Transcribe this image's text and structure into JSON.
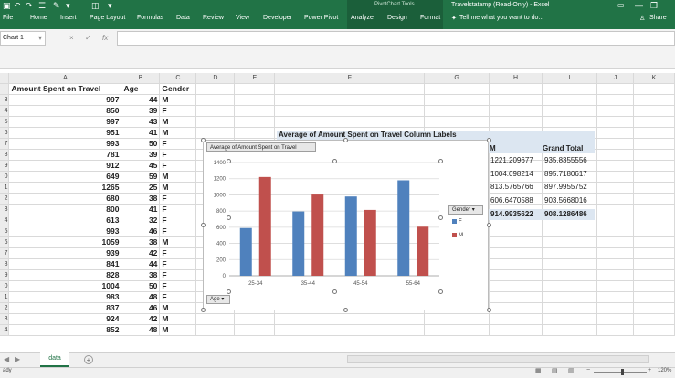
{
  "ribbon": {
    "context_header": "PivotChart Tools",
    "title": "Travelstatamp (Read-Only) - Excel",
    "file_label": "File",
    "tabs": [
      "Home",
      "Insert",
      "Page Layout",
      "Formulas",
      "Data",
      "Review",
      "View",
      "Developer",
      "Power Pivot",
      "Analyze",
      "Design",
      "Format"
    ],
    "tell_me": "Tell me what you want to do...",
    "share": "Share"
  },
  "formula_bar": {
    "name_box": "Chart 1",
    "fx": "fx",
    "cancel": "×",
    "confirm": "✓"
  },
  "grid": {
    "columns": [
      "A",
      "B",
      "C",
      "D",
      "E",
      "F",
      "G",
      "H",
      "I",
      "J",
      "K"
    ],
    "header_row": {
      "row": "",
      "a": "Amount Spent on Travel",
      "b": "Age",
      "c": "Gender"
    },
    "rows": [
      {
        "r": "3",
        "a": "997",
        "b": "44",
        "c": "M"
      },
      {
        "r": "4",
        "a": "850",
        "b": "39",
        "c": "F"
      },
      {
        "r": "5",
        "a": "997",
        "b": "43",
        "c": "M"
      },
      {
        "r": "6",
        "a": "951",
        "b": "41",
        "c": "M"
      },
      {
        "r": "7",
        "a": "993",
        "b": "50",
        "c": "F"
      },
      {
        "r": "8",
        "a": "781",
        "b": "39",
        "c": "F"
      },
      {
        "r": "9",
        "a": "912",
        "b": "45",
        "c": "F"
      },
      {
        "r": "0",
        "a": "649",
        "b": "59",
        "c": "M"
      },
      {
        "r": "1",
        "a": "1265",
        "b": "25",
        "c": "M"
      },
      {
        "r": "2",
        "a": "680",
        "b": "38",
        "c": "F"
      },
      {
        "r": "3",
        "a": "800",
        "b": "41",
        "c": "F"
      },
      {
        "r": "4",
        "a": "613",
        "b": "32",
        "c": "F"
      },
      {
        "r": "5",
        "a": "993",
        "b": "46",
        "c": "F"
      },
      {
        "r": "6",
        "a": "1059",
        "b": "38",
        "c": "M"
      },
      {
        "r": "7",
        "a": "939",
        "b": "42",
        "c": "F"
      },
      {
        "r": "8",
        "a": "841",
        "b": "44",
        "c": "F"
      },
      {
        "r": "9",
        "a": "828",
        "b": "38",
        "c": "F"
      },
      {
        "r": "0",
        "a": "1004",
        "b": "50",
        "c": "F"
      },
      {
        "r": "1",
        "a": "983",
        "b": "48",
        "c": "F"
      },
      {
        "r": "2",
        "a": "837",
        "b": "46",
        "c": "M"
      },
      {
        "r": "3",
        "a": "924",
        "b": "42",
        "c": "M"
      },
      {
        "r": "4",
        "a": "852",
        "b": "48",
        "c": "M"
      }
    ],
    "pivot": {
      "title": "Average of Amount Spent on Travel   Column Labels",
      "col_h": "M",
      "col_i": "Grand Total",
      "rows": [
        {
          "h": "1221.209677",
          "i": "935.8355556"
        },
        {
          "h": "1004.098214",
          "i": "895.7180617"
        },
        {
          "h": "813.5765766",
          "i": "897.9955752"
        },
        {
          "h": "606.6470588",
          "i": "903.5668016"
        },
        {
          "h": "914.9935622",
          "i": "908.1286486"
        }
      ]
    }
  },
  "chart": {
    "title_button": "Average of Amount Spent on Travel",
    "legend_button": "Gender",
    "axis_button": "Age",
    "legend": [
      {
        "name": "F",
        "color": "#4f81bd"
      },
      {
        "name": "M",
        "color": "#c0504d"
      }
    ]
  },
  "chart_data": {
    "type": "bar",
    "categories": [
      "25-34",
      "35-44",
      "45-54",
      "55-64"
    ],
    "series": [
      {
        "name": "F",
        "color": "#4f81bd",
        "values": [
          590,
          795,
          980,
          1180
        ]
      },
      {
        "name": "M",
        "color": "#c0504d",
        "values": [
          1221,
          1004,
          814,
          607
        ]
      }
    ],
    "ylim": [
      0,
      1400
    ],
    "yticks": [
      0,
      200,
      400,
      600,
      800,
      1000,
      1200,
      1400
    ],
    "grid": true,
    "legend_position": "right",
    "title": "",
    "xlabel": "",
    "ylabel": ""
  },
  "sheets": {
    "active": "data",
    "add": "+"
  },
  "status": {
    "left": "ady",
    "zoom": "120%"
  }
}
